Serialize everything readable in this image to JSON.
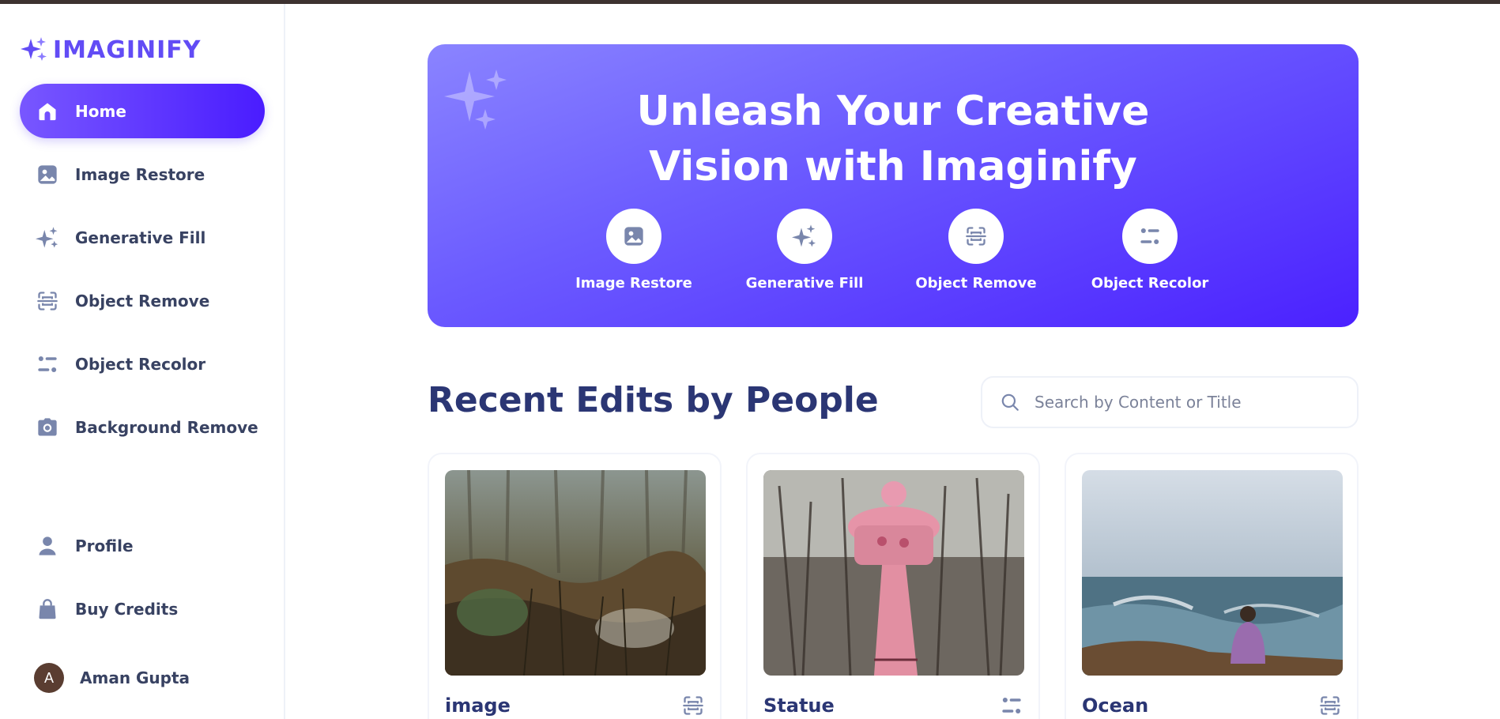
{
  "app": {
    "name": "IMAGINIFY"
  },
  "sidebar": {
    "items": [
      {
        "label": "Home",
        "icon": "home-icon",
        "active": true
      },
      {
        "label": "Image Restore",
        "icon": "image-icon"
      },
      {
        "label": "Generative Fill",
        "icon": "stars-icon"
      },
      {
        "label": "Object Remove",
        "icon": "scan-icon"
      },
      {
        "label": "Object Recolor",
        "icon": "filter-icon"
      },
      {
        "label": "Background Remove",
        "icon": "camera-icon"
      }
    ],
    "bottom_items": [
      {
        "label": "Profile",
        "icon": "user-icon"
      },
      {
        "label": "Buy Credits",
        "icon": "bag-icon"
      }
    ],
    "user": {
      "initial": "A",
      "name": "Aman Gupta"
    }
  },
  "banner": {
    "title_line1": "Unleash Your Creative",
    "title_line2": "Vision with Imaginify",
    "actions": [
      {
        "label": "Image Restore",
        "icon": "image-icon"
      },
      {
        "label": "Generative Fill",
        "icon": "stars-icon"
      },
      {
        "label": "Object Remove",
        "icon": "scan-icon"
      },
      {
        "label": "Object Recolor",
        "icon": "filter-icon"
      }
    ]
  },
  "recent": {
    "title": "Recent Edits by People",
    "search": {
      "placeholder": "Search by Content or Title",
      "value": ""
    },
    "cards": [
      {
        "title": "image",
        "transformation_icon": "scan-icon"
      },
      {
        "title": "Statue",
        "transformation_icon": "filter-icon"
      },
      {
        "title": "Ocean",
        "transformation_icon": "scan-icon"
      }
    ]
  },
  "colors": {
    "brand": "#624cf5",
    "gradient_start": "#7857ff",
    "gradient_end": "#4a1cff",
    "heading": "#2b3674",
    "text": "#384262",
    "icon": "#7986ac"
  }
}
